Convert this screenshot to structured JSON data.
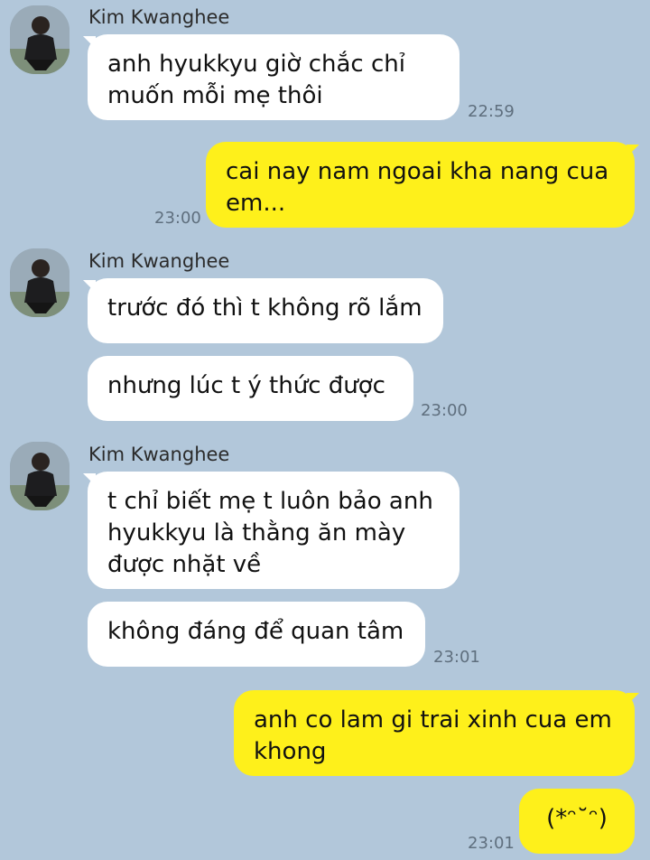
{
  "chat": {
    "messages": [
      {
        "sender": "Kim Kwanghee",
        "text": "anh hyukkyu giờ chắc chỉ muốn mỗi mẹ thôi",
        "time": "22:59"
      },
      {
        "sender": "me",
        "text": "cai nay nam ngoai kha nang cua em...",
        "time": "23:00"
      },
      {
        "sender": "Kim Kwanghee",
        "text": "trước đó thì t không rõ lắm"
      },
      {
        "sender": "Kim Kwanghee",
        "text": "nhưng lúc t ý thức được",
        "time": "23:00"
      },
      {
        "sender": "Kim Kwanghee",
        "text": "t chỉ biết mẹ t luôn bảo anh hyukkyu là thằng ăn mày được nhặt về"
      },
      {
        "sender": "Kim Kwanghee",
        "text": "không đáng để quan tâm",
        "time": "23:01"
      },
      {
        "sender": "me",
        "text": "anh co lam gi trai xinh cua em khong"
      },
      {
        "sender": "me",
        "text": "(*ᵔ˘ᵔ)",
        "time": "23:01"
      }
    ]
  },
  "colors": {
    "background": "#b2c7da",
    "incoming_bubble": "#ffffff",
    "outgoing_bubble": "#fef01b"
  }
}
